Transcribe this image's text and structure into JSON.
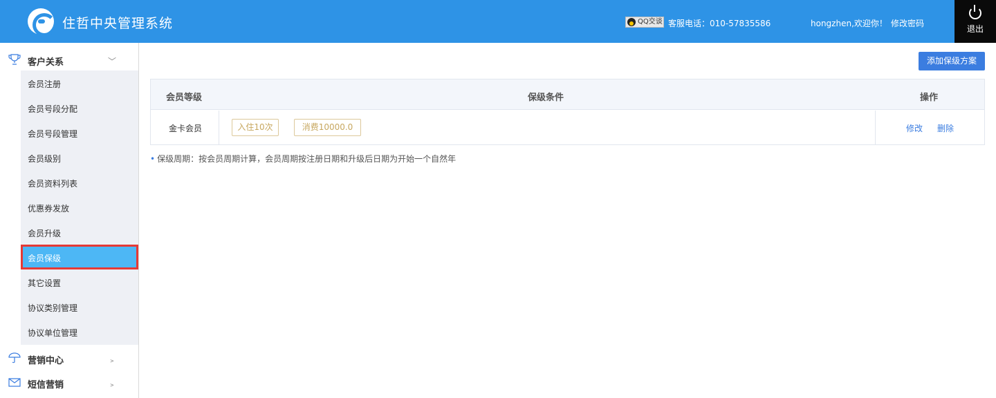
{
  "header": {
    "title": "住哲中央管理系统",
    "qq_badge": "QQ交谈",
    "service_phone": "客服电话：010-57835586",
    "greeting": "hongzhen,欢迎你！",
    "change_password": "修改密码",
    "logout": "退出",
    "bg_color": "#2e93e6"
  },
  "sidebar": {
    "groups": [
      {
        "label": "客户关系",
        "icon": "trophy-icon",
        "expanded": true
      },
      {
        "label": "营销中心",
        "icon": "umbrella-icon",
        "expanded": false
      },
      {
        "label": "短信营销",
        "icon": "envelope-icon",
        "expanded": false
      }
    ],
    "items": [
      {
        "label": "会员注册"
      },
      {
        "label": "会员号段分配"
      },
      {
        "label": "会员号段管理"
      },
      {
        "label": "会员级别"
      },
      {
        "label": "会员资料列表"
      },
      {
        "label": "优惠券发放"
      },
      {
        "label": "会员升级"
      },
      {
        "label": "会员保级",
        "active": true
      },
      {
        "label": "其它设置"
      },
      {
        "label": "协议类别管理"
      },
      {
        "label": "协议单位管理"
      }
    ],
    "active_color": "#4db7f5"
  },
  "main": {
    "add_button": "添加保级方案",
    "table": {
      "headers": {
        "level": "会员等级",
        "conditions": "保级条件",
        "ops": "操作"
      },
      "rows": [
        {
          "level": "金卡会员",
          "conditions": [
            "入住10次",
            "消费10000.0"
          ],
          "edit": "修改",
          "delete": "删除"
        }
      ]
    },
    "note": "保级周期：按会员周期计算，会员周期按注册日期和升级后日期为开始一个自然年"
  }
}
